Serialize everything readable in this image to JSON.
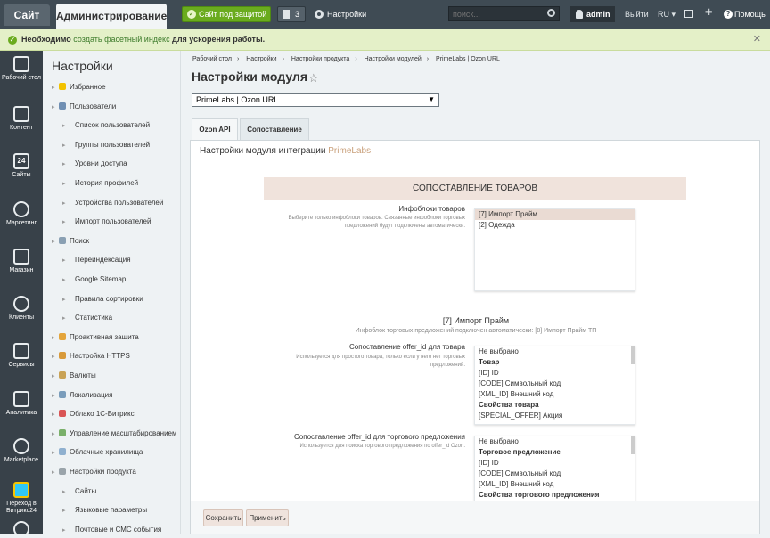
{
  "topbar": {
    "site_tab": "Сайт",
    "admin_tab": "Администрирование",
    "protect_label": "Сайт под защитой",
    "count": "3",
    "settings_label": "Настройки",
    "search_placeholder": "поиск...",
    "user": "admin",
    "logout": "Выйти",
    "lang": "RU",
    "help": "Помощь"
  },
  "notice": {
    "bold": "Необходимо",
    "link": "создать фасетный индекс",
    "rest": "для ускорения работы.",
    "close": "✕"
  },
  "iconbar": [
    {
      "label": "Рабочий стол",
      "icon": "home-icon"
    },
    {
      "label": "Контент",
      "icon": "document-icon"
    },
    {
      "label": "Сайты",
      "icon": "calendar-24-icon",
      "glyph": "24"
    },
    {
      "label": "Маркетинг",
      "icon": "target-icon"
    },
    {
      "label": "Магазин",
      "icon": "basket-icon"
    },
    {
      "label": "Клиенты",
      "icon": "clients-icon"
    },
    {
      "label": "Сервисы",
      "icon": "layers-icon"
    },
    {
      "label": "Аналитика",
      "icon": "bar-chart-icon"
    },
    {
      "label": "Marketplace",
      "icon": "cloud-download-icon"
    },
    {
      "label": "Переход в Битрикс24",
      "icon": "bitrix24-icon"
    },
    {
      "label": "",
      "icon": "settings-gear-icon"
    }
  ],
  "panel": {
    "title": "Настройки",
    "items": [
      {
        "label": "Избранное",
        "level": 0
      },
      {
        "label": "Пользователи",
        "level": 0
      },
      {
        "label": "Список пользователей",
        "level": 1
      },
      {
        "label": "Группы пользователей",
        "level": 1
      },
      {
        "label": "Уровни доступа",
        "level": 1
      },
      {
        "label": "История профилей",
        "level": 1
      },
      {
        "label": "Устройства пользователей",
        "level": 1
      },
      {
        "label": "Импорт пользователей",
        "level": 1
      },
      {
        "label": "Поиск",
        "level": 0
      },
      {
        "label": "Переиндексация",
        "level": 1
      },
      {
        "label": "Google Sitemap",
        "level": 1
      },
      {
        "label": "Правила сортировки",
        "level": 1
      },
      {
        "label": "Статистика",
        "level": 1
      },
      {
        "label": "Проактивная защита",
        "level": 0
      },
      {
        "label": "Настройка HTTPS",
        "level": 0
      },
      {
        "label": "Валюты",
        "level": 0
      },
      {
        "label": "Локализация",
        "level": 0
      },
      {
        "label": "Облако 1С-Битрикс",
        "level": 0
      },
      {
        "label": "Управление масштабированием",
        "level": 0
      },
      {
        "label": "Облачные хранилища",
        "level": 0
      },
      {
        "label": "Настройки продукта",
        "level": 0
      },
      {
        "label": "Сайты",
        "level": 1
      },
      {
        "label": "Языковые параметры",
        "level": 1
      },
      {
        "label": "Почтовые и СМС события",
        "level": 1
      }
    ]
  },
  "breadcrumbs": [
    "Рабочий стол",
    "Настройки",
    "Настройки продукта",
    "Настройки модулей",
    "PrimeLabs | Ozon URL"
  ],
  "page_title": "Настройки модуля",
  "module_select": "PrimeLabs | Ozon URL",
  "tabs": [
    "Ozon API",
    "Сопоставление"
  ],
  "box": {
    "title_prefix": "Настройки модуля интеграции",
    "title_brand": "PrimeLabs",
    "section": "СОПОСТАВЛЕНИЕ ТОВАРОВ",
    "iblocks_label": "Инфоблоки товаров",
    "iblocks_hint": "Выберите только инфоблоки товаров. Связанные инфоблоки торговых предложений будут подключены автоматически.",
    "iblocks_options": [
      "[7] Импорт Прайм",
      "[2] Одежда"
    ],
    "iblock_title": "[7] Импорт Прайм",
    "iblock_hint": "Инфоблок торговых предложений подключен автоматически: [8] Импорт Прайм ТП",
    "offer_label": "Сопоставление offer_id для товара",
    "offer_hint": "Используется для простого товара, только если у него нет торговых предложений.",
    "offer_options": [
      "Не выбрано",
      "Товар",
      "[ID] ID",
      "[CODE] Символьный код",
      "[XML_ID] Внешний код",
      "Свойства товара",
      "[SPECIAL_OFFER] Акция"
    ],
    "offer2_label": "Сопоставление offer_id для торгового предложения",
    "offer2_hint": "Используется для поиска торгового предложения по offer_id Ozon.",
    "offer2_options": [
      "Не выбрано",
      "Торговое предложение",
      "[ID] ID",
      "[CODE] Символьный код",
      "[XML_ID] Внешний код",
      "Свойства торгового предложения"
    ]
  },
  "buttons": {
    "save": "Сохранить",
    "apply": "Применить"
  }
}
